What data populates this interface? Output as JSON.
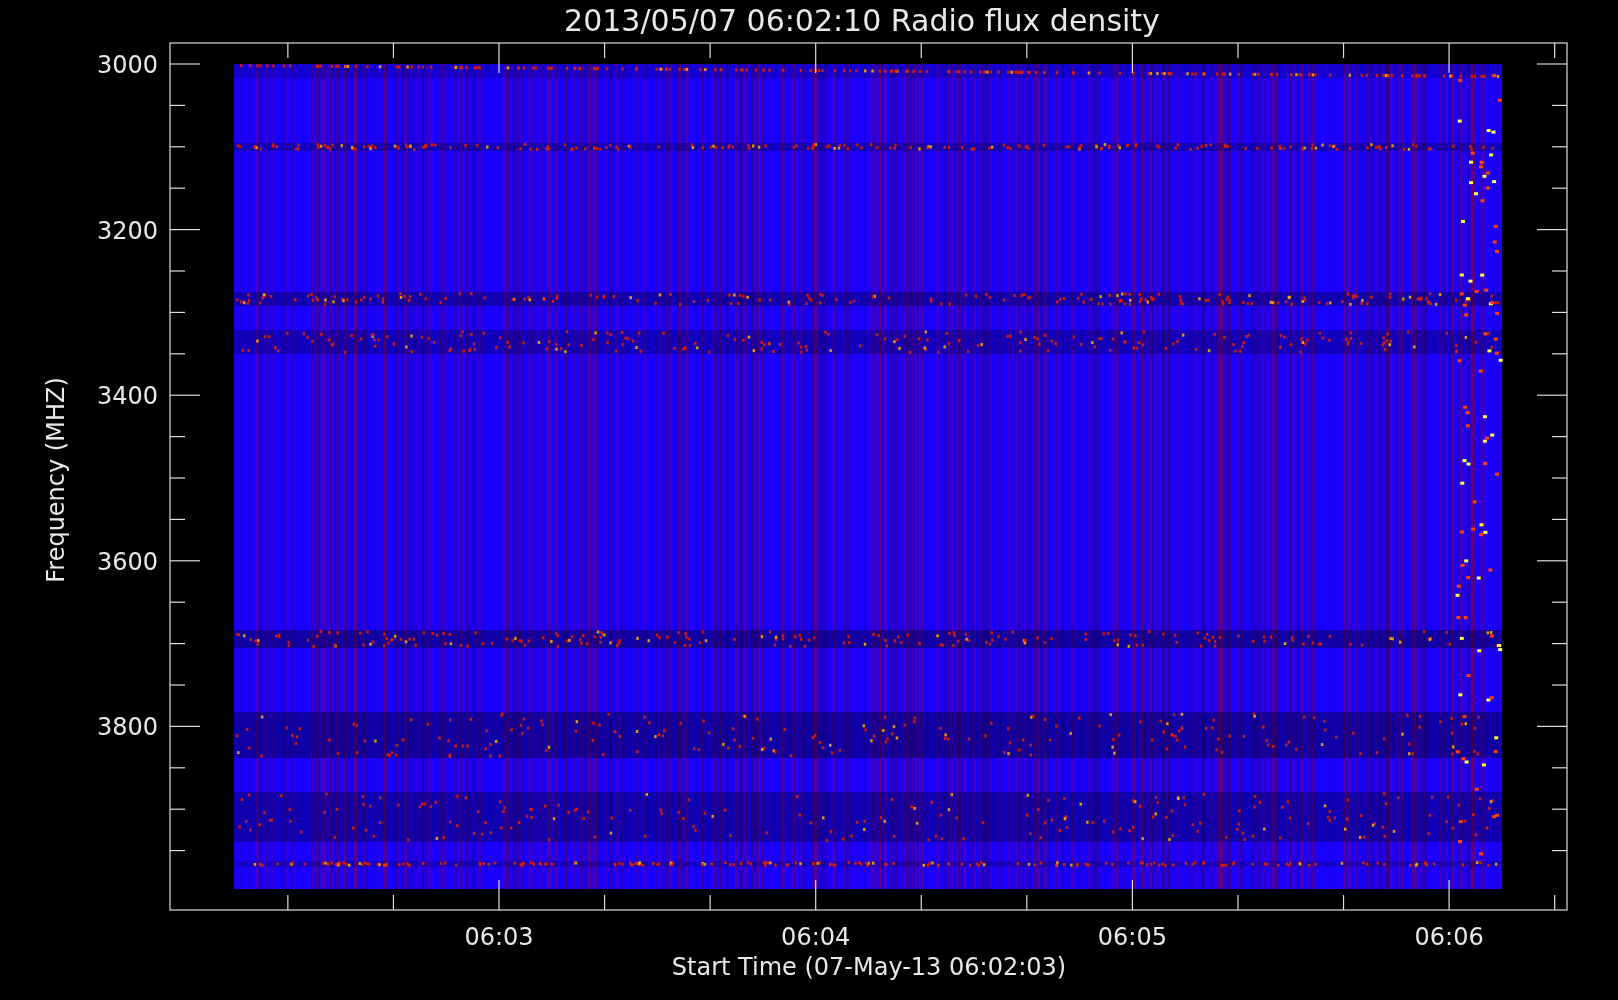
{
  "title": "2013/05/07 06:02:10 Radio flux density",
  "y_axis": {
    "label": "Frequency (MHZ)",
    "ticks": [
      "3000",
      "3200",
      "3400",
      "3600",
      "3800"
    ]
  },
  "x_axis": {
    "label": "Start Time (07-May-13 06:02:03)",
    "ticks": [
      "06:03",
      "06:04",
      "06:05",
      "06:06"
    ]
  }
}
